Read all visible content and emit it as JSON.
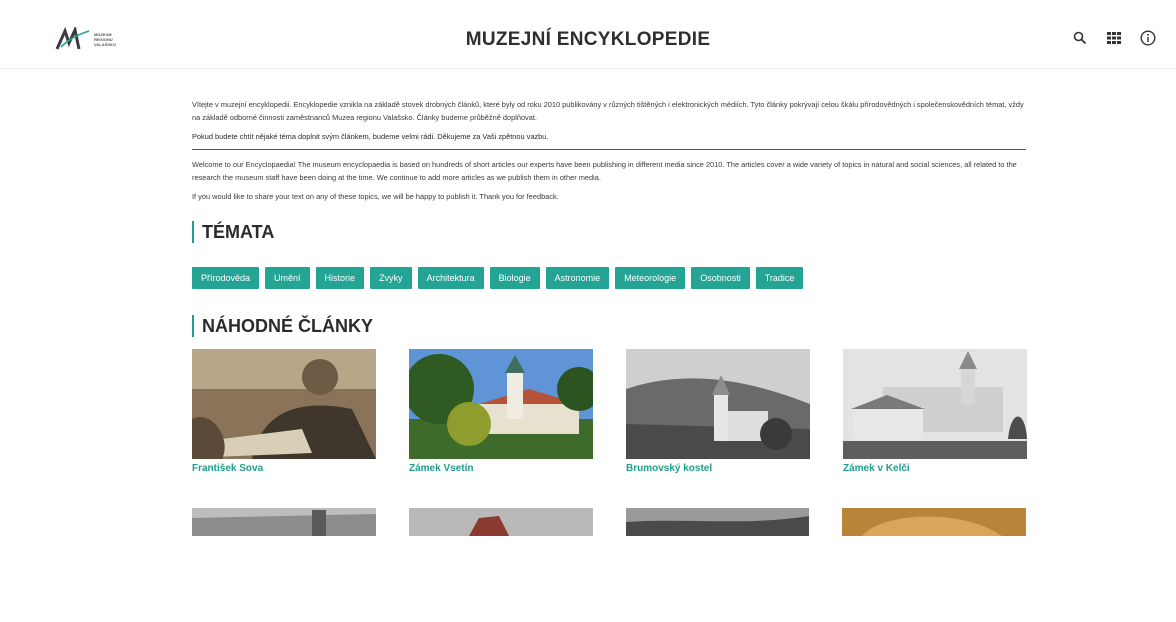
{
  "header": {
    "logo_text": [
      "MUZEUM",
      "REGIONU",
      "VALAŠSKO"
    ],
    "title": "MUZEJNÍ ENCYKLOPEDIE",
    "icons": [
      "search-icon",
      "grid-icon",
      "info-icon"
    ]
  },
  "intro": {
    "cz_p1": "Vítejte v muzejní encyklopedii. Encyklopedie vznikla na základě stovek drobných článků, které byly od roku 2010 publikovány v různých tištěných i elektronických médiích. Tyto články pokrývají celou škálu přírodovědných i společenskovědních témat, vždy na základě odborné činnosti zaměstnanců Muzea regionu Valašsko. Články budeme průběžně doplňovat.",
    "cz_p2": "Pokud budete chtít nějaké téma doplnit svým článkem, budeme velmi rádi. Děkujeme za Vaši zpětnou vazbu.",
    "en_p1": "Welcome to our Encyclopaedia! The museum encyclopaedia is based on hundreds of short articles our experts have been publishing in different media since 2010. The articles cover a wide variety of topics in natural and social sciences, all related to the research the museum staff have been doing at the time. We continue to add more articles as we publish them in other media.",
    "en_p2": "If you would like to share your text on any of these topics, we will be happy to publish it. Thank you for feedback."
  },
  "topics": {
    "title": "TÉMATA",
    "items": [
      "Přírodověda",
      "Umění",
      "Historie",
      "Zvyky",
      "Architektura",
      "Biologie",
      "Astronomie",
      "Meteorologie",
      "Osobnosti",
      "Tradice"
    ]
  },
  "random": {
    "title": "NÁHODNÉ ČLÁNKY",
    "cards": [
      {
        "title": "František Sova",
        "image": "portrait-photo"
      },
      {
        "title": "Zámek Vsetín",
        "image": "castle-photo"
      },
      {
        "title": "Brumovský kostel",
        "image": "church-photo"
      },
      {
        "title": "Zámek v Kelči",
        "image": "chateau-photo"
      }
    ]
  },
  "colors": {
    "accent": "#23a495",
    "title_accent": "#1f9e8e"
  }
}
